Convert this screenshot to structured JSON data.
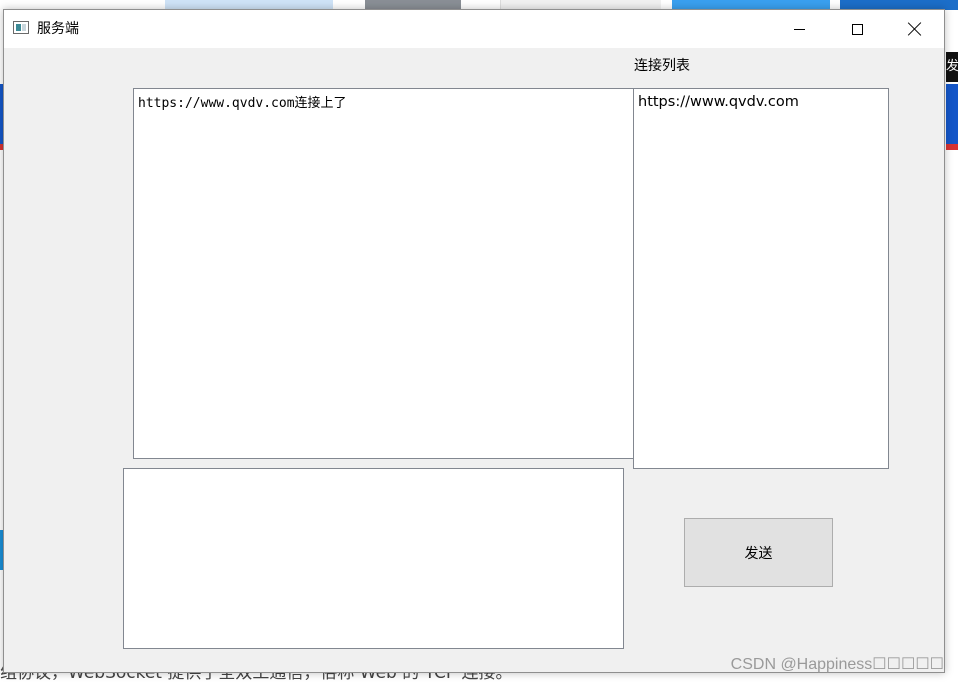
{
  "background_page": {
    "caption": "组协议，WebSocket 提供了全双工通信，俗称 Web 的 TCP 连接。",
    "watermark": "CSDN @Happiness☐☐☐☐☐",
    "right_edge_char": "发"
  },
  "window": {
    "title": "服务端",
    "icon": "app-window-icon",
    "controls": {
      "minimize_icon": "minimize-icon",
      "maximize_icon": "maximize-icon",
      "close_icon": "close-icon"
    }
  },
  "main": {
    "connection_list_label": "连接列表",
    "message_log": "https://www.qvdv.com连接上了",
    "connection_list_items": [
      "https://www.qvdv.com"
    ],
    "send_input_value": "",
    "send_button_label": "发送"
  },
  "colors": {
    "window_bg": "#f0f0f0",
    "titlebar_bg": "#ffffff",
    "textbox_border": "#828790",
    "button_bg": "#e1e1e1"
  }
}
